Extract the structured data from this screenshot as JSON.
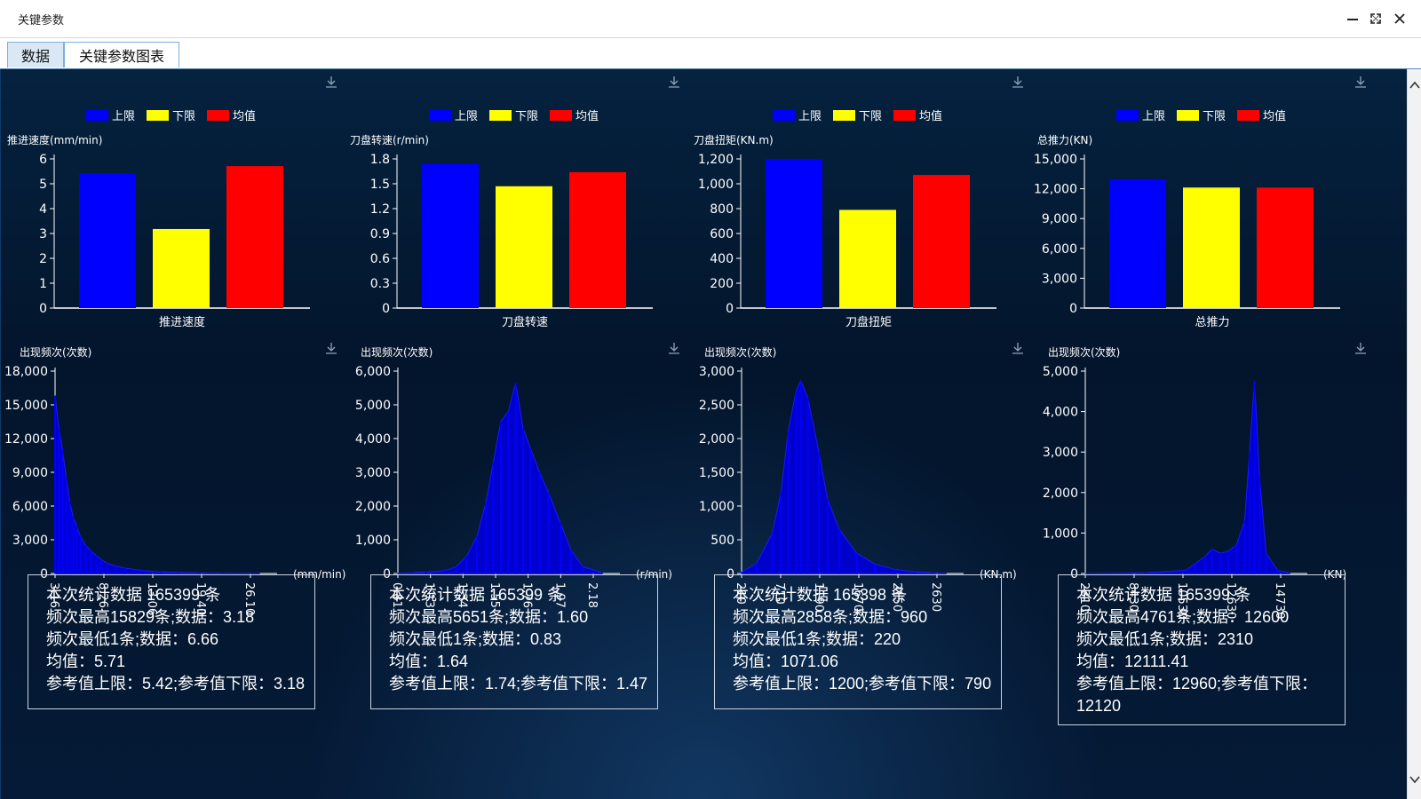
{
  "window": {
    "title": "关键参数"
  },
  "tabs": [
    {
      "label": "数据",
      "active": false
    },
    {
      "label": "关键参数图表",
      "active": true
    }
  ],
  "colors": {
    "upper": "#0000ff",
    "lower": "#ffff00",
    "mean": "#ff0000",
    "histogram": "#0000cc"
  },
  "legend": [
    "上限",
    "下限",
    "均值"
  ],
  "panels": [
    {
      "bar": {
        "ytitle": "推进速度(mm/min)",
        "xlabel": "推进速度",
        "yticks": [
          "0",
          "1",
          "2",
          "3",
          "4",
          "5",
          "6"
        ],
        "ymax": 6
      },
      "hist": {
        "ytitle": "出现频次(次数)",
        "unit": "(mm/min)",
        "yticks": [
          "0",
          "3,000",
          "6,000",
          "9,000",
          "12,000",
          "15,000",
          "18,000"
        ],
        "ymax": 18000,
        "xticks": [
          "3.16",
          "8.26",
          "13.06",
          "19.40",
          "26.10"
        ]
      },
      "stats": {
        "line1": "本次统计数据 165399 条",
        "line2": "频次最高15829条;数据：3.18",
        "line3": "频次最低1条;数据：6.66",
        "line4": "均值：5.71",
        "line5": "参考值上限：5.42;参考值下限：3.18"
      }
    },
    {
      "bar": {
        "ytitle": "刀盘转速(r/min)",
        "xlabel": "刀盘转速",
        "yticks": [
          "0",
          "0.3",
          "0.6",
          "0.9",
          "1.2",
          "1.5",
          "1.8"
        ],
        "ymax": 1.8
      },
      "hist": {
        "ytitle": "出现频次(次数)",
        "unit": "(r/min)",
        "yticks": [
          "0",
          "1,000",
          "2,000",
          "3,000",
          "4,000",
          "5,000",
          "6,000"
        ],
        "ymax": 6000,
        "xticks": [
          "0.81",
          "1.13",
          "1.34",
          "1.55",
          "1.76",
          "1.97",
          "2.18"
        ]
      },
      "stats": {
        "line1": "本次统计数据 165399 条",
        "line2": "频次最高5651条;数据：1.60",
        "line3": "频次最低1条;数据：0.83",
        "line4": "均值：1.64",
        "line5": "参考值上限：1.74;参考值下限：1.47"
      }
    },
    {
      "bar": {
        "ytitle": "刀盘扭矩(KN.m)",
        "xlabel": "刀盘扭矩",
        "yticks": [
          "0",
          "200",
          "400",
          "600",
          "800",
          "1,000",
          "1,200"
        ],
        "ymax": 1200
      },
      "hist": {
        "ytitle": "出现频次(次数)",
        "unit": "(KN.m)",
        "yticks": [
          "0",
          "500",
          "1,000",
          "1,500",
          "2,000",
          "2,500",
          "3,000"
        ],
        "ymax": 3000,
        "xticks": [
          "210",
          "710",
          "1190",
          "1670",
          "2150",
          "2630"
        ]
      },
      "stats": {
        "line1": "本次统计数据 165398 条",
        "line2": "频次最高2858条;数据：960",
        "line3": "频次最低1条;数据：220",
        "line4": "均值：1071.06",
        "line5": "参考值上限：1200;参考值下限：790"
      }
    },
    {
      "bar": {
        "ytitle": "总推力(KN)",
        "xlabel": "总推力",
        "yticks": [
          "0",
          "3,000",
          "6,000",
          "9,000",
          "12,000",
          "15,000"
        ],
        "ymax": 15000
      },
      "hist": {
        "ytitle": "出现频次(次数)",
        "unit": "(KN)",
        "yticks": [
          "0",
          "1,000",
          "2,000",
          "3,000",
          "4,000",
          "5,000"
        ],
        "ymax": 5000,
        "xticks": [
          "2310",
          "8430",
          "10530",
          "12630",
          "14730"
        ]
      },
      "stats": {
        "line1": "本次统计数据 165399 条",
        "line2": "频次最高4761条;数据：12600",
        "line3": "频次最低1条;数据：2310",
        "line4": "均值：12111.41",
        "line5": "参考值上限：12960;参考值下限：12120"
      }
    }
  ],
  "chart_data": [
    {
      "type": "bar",
      "categories": [
        "推进速度"
      ],
      "series": [
        {
          "name": "上限",
          "values": [
            5.42
          ]
        },
        {
          "name": "下限",
          "values": [
            3.18
          ]
        },
        {
          "name": "均值",
          "values": [
            5.71
          ]
        }
      ],
      "ylabel": "推进速度(mm/min)",
      "xlabel": "推进速度",
      "ylim": [
        0,
        6
      ],
      "legend": "top"
    },
    {
      "type": "bar",
      "categories": [
        "刀盘转速"
      ],
      "series": [
        {
          "name": "上限",
          "values": [
            1.74
          ]
        },
        {
          "name": "下限",
          "values": [
            1.47
          ]
        },
        {
          "name": "均值",
          "values": [
            1.64
          ]
        }
      ],
      "ylabel": "刀盘转速(r/min)",
      "xlabel": "刀盘转速",
      "ylim": [
        0,
        1.8
      ],
      "legend": "top"
    },
    {
      "type": "bar",
      "categories": [
        "刀盘扭矩"
      ],
      "series": [
        {
          "name": "上限",
          "values": [
            1200
          ]
        },
        {
          "name": "下限",
          "values": [
            790
          ]
        },
        {
          "name": "均值",
          "values": [
            1071.06
          ]
        }
      ],
      "ylabel": "刀盘扭矩(KN.m)",
      "xlabel": "刀盘扭矩",
      "ylim": [
        0,
        1200
      ],
      "legend": "top"
    },
    {
      "type": "bar",
      "categories": [
        "总推力"
      ],
      "series": [
        {
          "name": "上限",
          "values": [
            12960
          ]
        },
        {
          "name": "下限",
          "values": [
            12120
          ]
        },
        {
          "name": "均值",
          "values": [
            12111.41
          ]
        }
      ],
      "ylabel": "总推力(KN)",
      "xlabel": "总推力",
      "ylim": [
        0,
        15000
      ],
      "legend": "top"
    },
    {
      "type": "bar",
      "ylabel": "出现频次(次数)",
      "xlabel": "(mm/min)",
      "ylim": [
        0,
        18000
      ],
      "x": [
        3.16,
        3.6,
        4.0,
        4.4,
        4.8,
        5.2,
        5.6,
        6.0,
        6.6,
        7.2,
        7.8,
        8.26,
        9.0,
        10.0,
        11.0,
        12.0,
        13.06,
        15.0,
        17.0,
        19.4,
        22.0,
        26.1
      ],
      "values": [
        15829,
        12800,
        11000,
        8600,
        6400,
        5000,
        4200,
        3300,
        2500,
        2000,
        1600,
        1300,
        900,
        650,
        480,
        360,
        260,
        150,
        90,
        55,
        25,
        10
      ]
    },
    {
      "type": "bar",
      "ylabel": "出现频次(次数)",
      "xlabel": "(r/min)",
      "ylim": [
        0,
        6000
      ],
      "x": [
        0.81,
        0.9,
        1.0,
        1.13,
        1.2,
        1.27,
        1.34,
        1.4,
        1.45,
        1.5,
        1.55,
        1.6,
        1.65,
        1.7,
        1.76,
        1.82,
        1.9,
        1.97,
        2.05,
        2.18
      ],
      "values": [
        10,
        20,
        40,
        90,
        200,
        500,
        1100,
        2100,
        3300,
        4500,
        4800,
        5651,
        4300,
        3700,
        3000,
        2400,
        1500,
        700,
        200,
        30
      ]
    },
    {
      "type": "bar",
      "ylabel": "出现频次(次数)",
      "xlabel": "(KN.m)",
      "ylim": [
        0,
        3000
      ],
      "x": [
        210,
        400,
        600,
        710,
        800,
        900,
        960,
        1050,
        1190,
        1300,
        1450,
        1670,
        1900,
        2150,
        2400,
        2630,
        2800
      ],
      "values": [
        20,
        150,
        600,
        1200,
        2100,
        2700,
        2858,
        2600,
        1800,
        1100,
        650,
        300,
        140,
        60,
        25,
        10,
        5
      ]
    },
    {
      "type": "bar",
      "ylabel": "出现频次(次数)",
      "xlabel": "(KN)",
      "ylim": [
        0,
        5000
      ],
      "x": [
        2310,
        6000,
        8430,
        9000,
        9600,
        10000,
        10530,
        11000,
        11500,
        12000,
        12300,
        12600,
        12900,
        13300,
        14000,
        14730
      ],
      "values": [
        1,
        20,
        80,
        250,
        420,
        600,
        500,
        550,
        700,
        1300,
        3000,
        4761,
        2400,
        500,
        80,
        10
      ]
    }
  ]
}
